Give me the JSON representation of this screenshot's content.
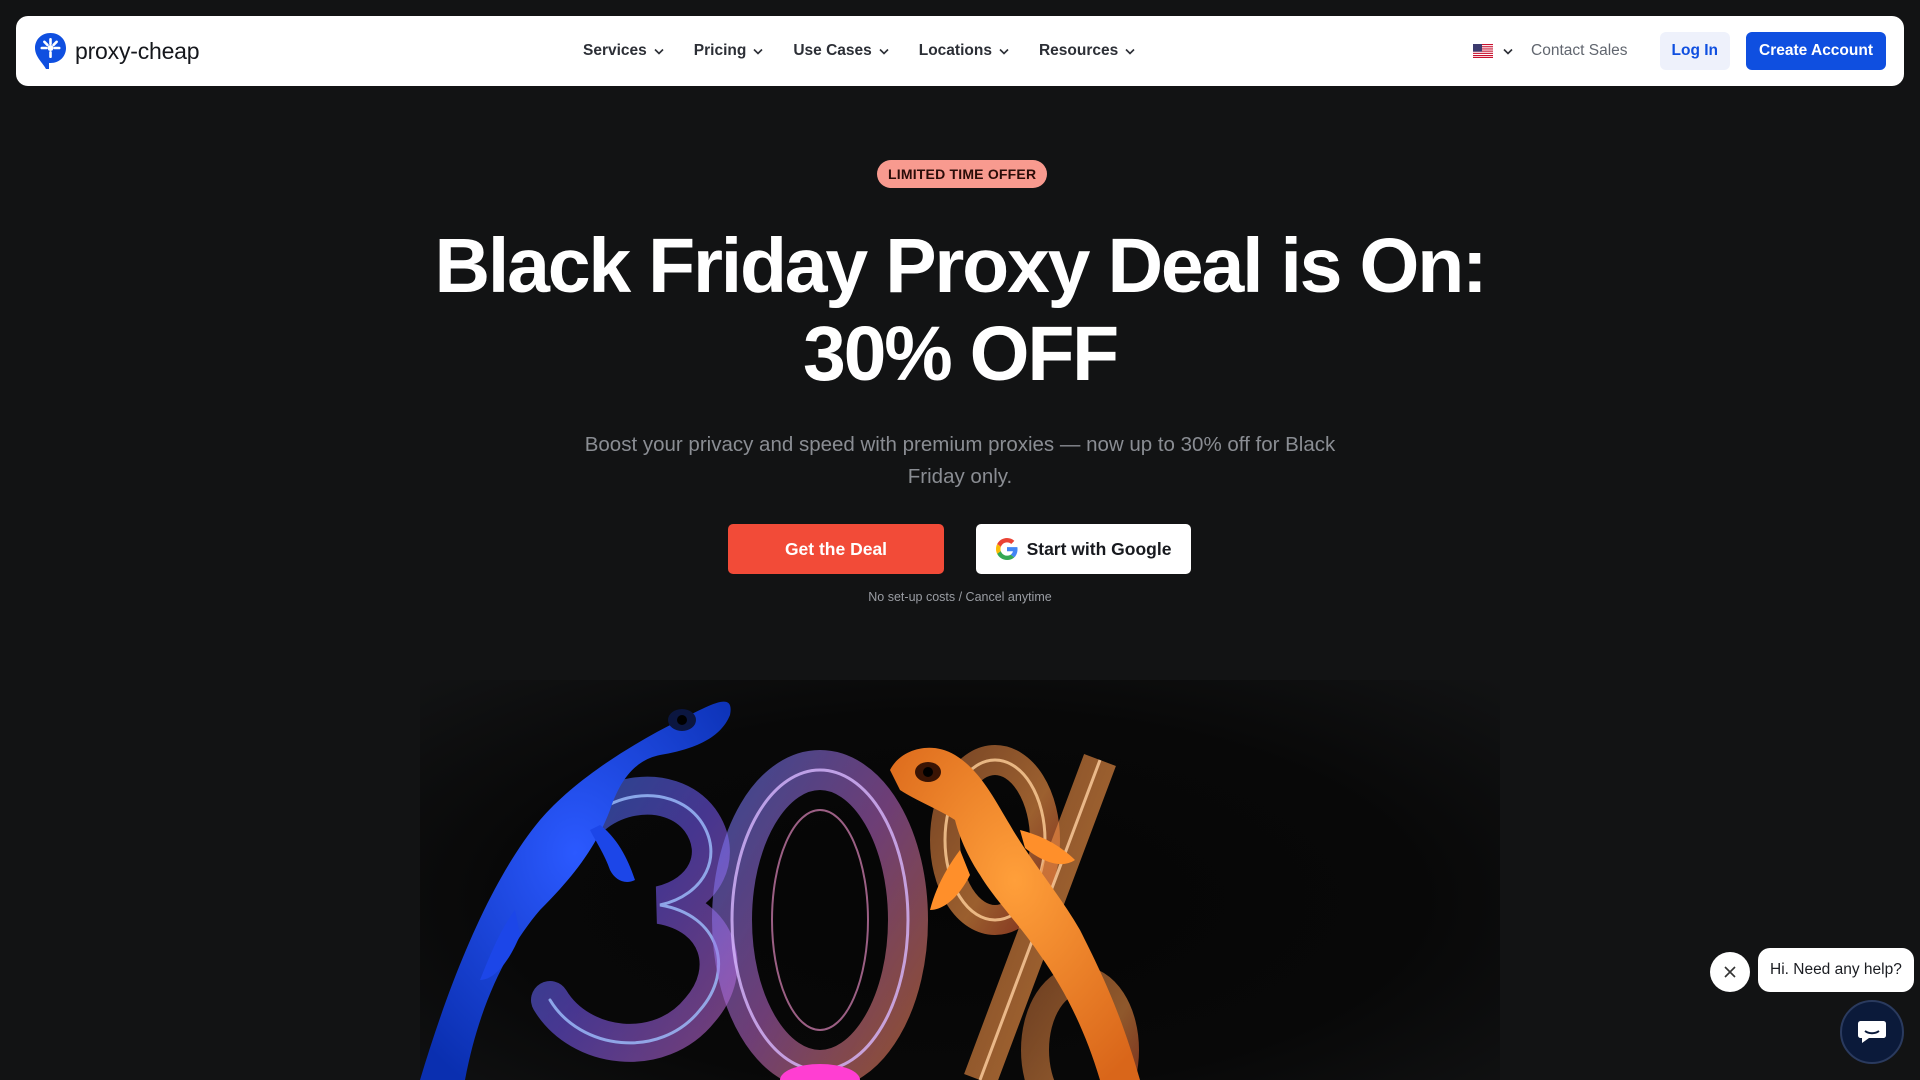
{
  "brand": {
    "name": "proxy-cheap"
  },
  "nav": {
    "items": [
      {
        "label": "Services"
      },
      {
        "label": "Pricing"
      },
      {
        "label": "Use Cases"
      },
      {
        "label": "Locations"
      },
      {
        "label": "Resources"
      }
    ],
    "language_icon": "us-flag-icon",
    "contact_label": "Contact Sales",
    "login_label": "Log In",
    "create_account_label": "Create Account"
  },
  "hero": {
    "badge": "LIMITED TIME OFFER",
    "title_line1": "Black Friday Proxy Deal is On:",
    "title_line2": "30% OFF",
    "subtitle": "Boost your privacy and speed with premium proxies — now up to 30% off for Black Friday only.",
    "primary_cta": "Get the Deal",
    "google_cta": "Start with Google",
    "note": "No set-up costs / Cancel anytime"
  },
  "chat": {
    "greeting": "Hi. Need any help?",
    "close_icon": "close-icon",
    "launcher_icon": "chat-icon"
  },
  "colors": {
    "background": "#121314",
    "accent_blue": "#0f4fe0",
    "deal_red": "#f24b38",
    "badge_bg": "#f89a8f"
  }
}
